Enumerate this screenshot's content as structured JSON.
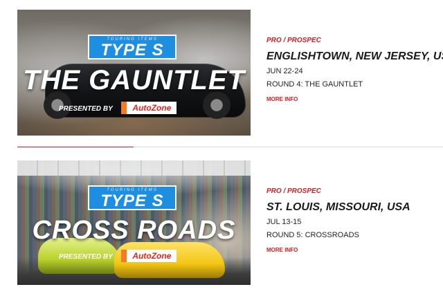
{
  "events": [
    {
      "logo": {
        "brand_small": "TOURING ITEMS",
        "brand": "TYPE S",
        "event_name": "THE GAUNTLET",
        "presented_by": "PRESENTED BY",
        "sponsor": "AutoZone"
      },
      "series": "PRO / PROSPEC",
      "location": "ENGLISHTOWN, NEW JERSEY, USA",
      "dates": "JUN 22-24",
      "round": "ROUND 4: THE GAUNTLET",
      "more_info": "MORE INFO"
    },
    {
      "logo": {
        "brand_small": "TOURING ITEMS",
        "brand": "TYPE S",
        "event_name": "CROSS ROADS",
        "presented_by": "PRESENTED BY",
        "sponsor": "AutoZone"
      },
      "series": "PRO / PROSPEC",
      "location": "ST. LOUIS, MISSOURI, USA",
      "dates": "JUL 13-15",
      "round": "ROUND 5: CROSSROADS",
      "more_info": "MORE INFO"
    }
  ],
  "colors": {
    "accent_red": "#d21f26",
    "logo_blue": "#1d8ee0",
    "divider": "#d7d7d7"
  }
}
